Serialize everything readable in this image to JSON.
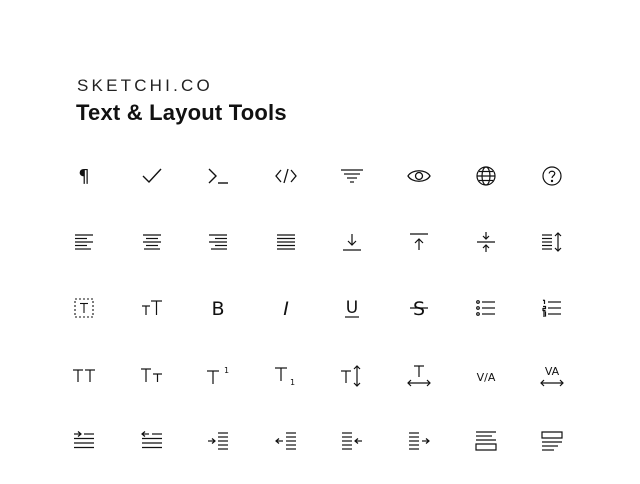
{
  "header": {
    "brand": "SKETCHI.CO",
    "title": "Text & Layout Tools"
  },
  "icons": [
    [
      "pilcrow-icon",
      "checkmark-icon",
      "terminal-prompt-icon",
      "code-tags-icon",
      "filter-lines-icon",
      "eye-icon",
      "globe-icon",
      "help-circle-icon"
    ],
    [
      "align-left-icon",
      "align-center-icon",
      "align-right-icon",
      "align-justify-icon",
      "align-bottom-icon",
      "align-top-icon",
      "vertical-center-icon",
      "line-height-icon"
    ],
    [
      "text-box-icon",
      "text-size-icon",
      "bold-icon",
      "italic-icon",
      "underline-icon",
      "strikethrough-icon",
      "bulleted-list-icon",
      "numbered-list-icon"
    ],
    [
      "all-caps-icon",
      "small-caps-icon",
      "superscript-icon",
      "subscript-icon",
      "vertical-scale-icon",
      "horizontal-scale-icon",
      "kerning-icon",
      "tracking-icon"
    ],
    [
      "indent-first-line-icon",
      "outdent-first-line-icon",
      "indent-left-icon",
      "outdent-left-icon",
      "indent-right-icon",
      "outdent-right-icon",
      "space-after-icon",
      "space-before-icon"
    ]
  ],
  "glyphs": {
    "pilcrow": "¶",
    "bold": "B",
    "italic": "I",
    "underline": "U",
    "strike": "S",
    "tt": "TT",
    "t": "T",
    "small_t": "T",
    "sup": "1",
    "sub": "1",
    "va": "V/A",
    "va2": "VA"
  }
}
